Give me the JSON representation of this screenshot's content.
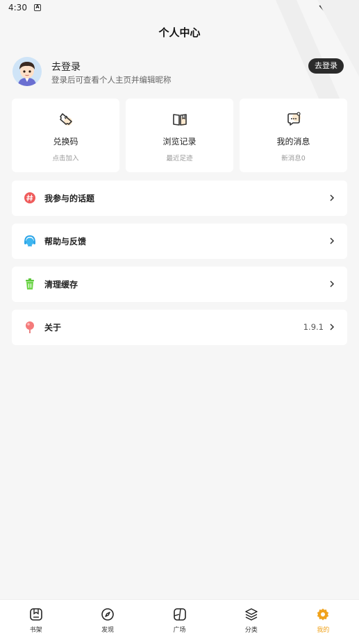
{
  "status": {
    "time": "4:30"
  },
  "header": {
    "title": "个人中心"
  },
  "profile": {
    "name": "去登录",
    "subtitle": "登录后可查看个人主页并编辑昵称",
    "login_button": "去登录"
  },
  "cards": [
    {
      "title": "兑换码",
      "subtitle": "点击加入",
      "icon": "ticket-icon"
    },
    {
      "title": "浏览记录",
      "subtitle": "最近足迹",
      "icon": "book-icon"
    },
    {
      "title": "我的消息",
      "subtitle": "新消息0",
      "icon": "message-icon"
    }
  ],
  "menu": [
    {
      "label": "我参与的话题",
      "icon": "hashtag-icon",
      "value": ""
    },
    {
      "label": "帮助与反馈",
      "icon": "headset-icon",
      "value": ""
    },
    {
      "label": "清理缓存",
      "icon": "trash-icon",
      "value": ""
    },
    {
      "label": "关于",
      "icon": "pin-icon",
      "value": "1.9.1"
    }
  ],
  "tabs": [
    {
      "label": "书架",
      "icon": "bookshelf-icon",
      "active": false
    },
    {
      "label": "发现",
      "icon": "compass-icon",
      "active": false
    },
    {
      "label": "广场",
      "icon": "square-icon",
      "active": false
    },
    {
      "label": "分类",
      "icon": "layers-icon",
      "active": false
    },
    {
      "label": "我的",
      "icon": "gear-icon",
      "active": true
    }
  ],
  "colors": {
    "accent": "#f0a21b",
    "background": "#f6f6f6",
    "button_dark": "#2b2b2b"
  }
}
